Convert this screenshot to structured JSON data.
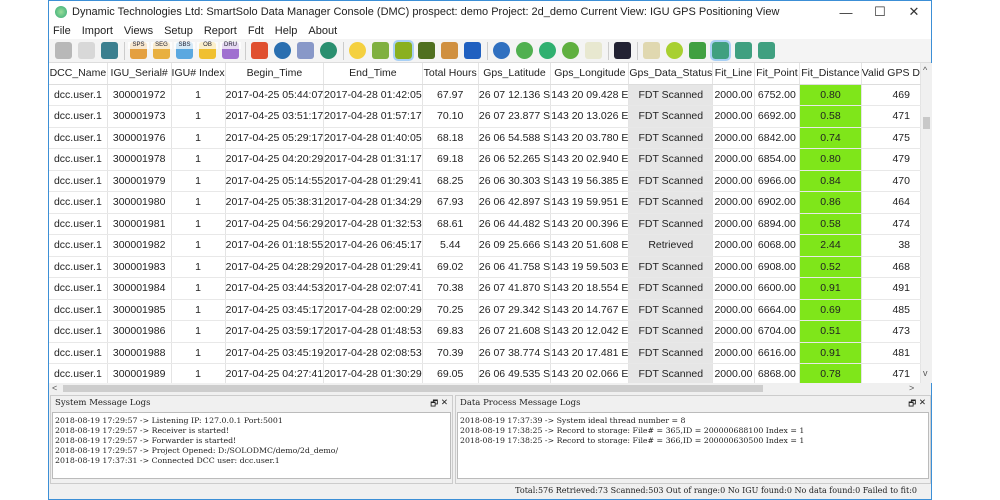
{
  "window": {
    "title": "Dynamic Technologies Ltd: SmartSolo Data Manager Console (DMC) prospect: demo  Project: 2d_demo   Current View: IGU GPS Positioning View",
    "minimize": "—",
    "maximize": "☐",
    "close": "✕"
  },
  "menu": [
    "File",
    "Import",
    "Views",
    "Setup",
    "Report",
    "Fdt",
    "Help",
    "About"
  ],
  "toolbar": [
    {
      "name": "new-project",
      "color": "#b8b8b8"
    },
    {
      "name": "open",
      "color": "#d8d8d8"
    },
    {
      "name": "robot",
      "color": "#3b7f8f"
    },
    null,
    {
      "name": "import-sps",
      "color": "#e4a040",
      "label": "SPS"
    },
    {
      "name": "import-seg",
      "color": "#e8b040",
      "label": "SEG"
    },
    {
      "name": "import-sbs",
      "color": "#5aa8e0",
      "label": "SBS"
    },
    {
      "name": "import-ob",
      "color": "#f0c030",
      "label": "OB"
    },
    {
      "name": "import-dru",
      "color": "#a070d0",
      "label": "DRU"
    },
    null,
    {
      "name": "list",
      "color": "#e05030"
    },
    {
      "name": "globe",
      "color": "#2a6fb0",
      "round": true
    },
    {
      "name": "link",
      "color": "#8898c8"
    },
    {
      "name": "grid-globe",
      "color": "#2a8f6f",
      "round": true
    },
    null,
    {
      "name": "sun",
      "color": "#f4d040",
      "round": true
    },
    {
      "name": "map-pin",
      "color": "#80b040"
    },
    {
      "name": "gps-view",
      "color": "#8ab020",
      "active": true
    },
    {
      "name": "terrain",
      "color": "#507020"
    },
    {
      "name": "folder-photo",
      "color": "#d09040"
    },
    {
      "name": "book",
      "color": "#2060c0"
    },
    null,
    {
      "name": "world",
      "color": "#3070c0",
      "round": true
    },
    {
      "name": "wave",
      "color": "#50b050",
      "round": true
    },
    {
      "name": "refresh",
      "color": "#30b070",
      "round": true
    },
    {
      "name": "filter",
      "color": "#60b040",
      "round": true
    },
    {
      "name": "document",
      "color": "#e8e8d0"
    },
    null,
    {
      "name": "device",
      "color": "#223"
    },
    null,
    {
      "name": "report-filter",
      "color": "#e0d8b0"
    },
    {
      "name": "ball",
      "color": "#a8d030",
      "round": true
    },
    {
      "name": "target",
      "color": "#40a040"
    },
    {
      "name": "checklist",
      "color": "#40a080",
      "active": true
    },
    {
      "name": "checklist-remove",
      "color": "#40a080"
    },
    {
      "name": "checklist-add",
      "color": "#40a080"
    }
  ],
  "table": {
    "columns": [
      "DCC_Name",
      "IGU_Serial#",
      "IGU# Index",
      "Begin_Time",
      "End_Time",
      "Total Hours",
      "Gps_Latitude",
      "Gps_Longitude",
      "Gps_Data_Status",
      "Fit_Line",
      "Fit_Point",
      "Fit_Distance",
      "Valid GPS D"
    ],
    "fit_distance_color": "#7fe61a",
    "rows": [
      [
        "dcc.user.1",
        "300001972",
        "1",
        "2017-04-25 05:44:07",
        "2017-04-28 01:42:05",
        "67.97",
        "26 07 12.136 S",
        "143 20 09.428 E",
        "FDT Scanned",
        "2000.00",
        "6752.00",
        "0.80",
        "469"
      ],
      [
        "dcc.user.1",
        "300001973",
        "1",
        "2017-04-25 03:51:17",
        "2017-04-28 01:57:17",
        "70.10",
        "26 07 23.877 S",
        "143 20 13.026 E",
        "FDT Scanned",
        "2000.00",
        "6692.00",
        "0.58",
        "471"
      ],
      [
        "dcc.user.1",
        "300001976",
        "1",
        "2017-04-25 05:29:17",
        "2017-04-28 01:40:05",
        "68.18",
        "26 06 54.588 S",
        "143 20 03.780 E",
        "FDT Scanned",
        "2000.00",
        "6842.00",
        "0.74",
        "475"
      ],
      [
        "dcc.user.1",
        "300001978",
        "1",
        "2017-04-25 04:20:29",
        "2017-04-28 01:31:17",
        "69.18",
        "26 06 52.265 S",
        "143 20 02.940 E",
        "FDT Scanned",
        "2000.00",
        "6854.00",
        "0.80",
        "479"
      ],
      [
        "dcc.user.1",
        "300001979",
        "1",
        "2017-04-25 05:14:55",
        "2017-04-28 01:29:41",
        "68.25",
        "26 06 30.303 S",
        "143 19 56.385 E",
        "FDT Scanned",
        "2000.00",
        "6966.00",
        "0.84",
        "470"
      ],
      [
        "dcc.user.1",
        "300001980",
        "1",
        "2017-04-25 05:38:31",
        "2017-04-28 01:34:29",
        "67.93",
        "26 06 42.897 S",
        "143 19 59.951 E",
        "FDT Scanned",
        "2000.00",
        "6902.00",
        "0.86",
        "464"
      ],
      [
        "dcc.user.1",
        "300001981",
        "1",
        "2017-04-25 04:56:29",
        "2017-04-28 01:32:53",
        "68.61",
        "26 06 44.482 S",
        "143 20 00.396 E",
        "FDT Scanned",
        "2000.00",
        "6894.00",
        "0.58",
        "474"
      ],
      [
        "dcc.user.1",
        "300001982",
        "1",
        "2017-04-26 01:18:55",
        "2017-04-26 06:45:17",
        "5.44",
        "26 09 25.666 S",
        "143 20 51.608 E",
        "Retrieved",
        "2000.00",
        "6068.00",
        "2.44",
        "38"
      ],
      [
        "dcc.user.1",
        "300001983",
        "1",
        "2017-04-25 04:28:29",
        "2017-04-28 01:29:41",
        "69.02",
        "26 06 41.758 S",
        "143 19 59.503 E",
        "FDT Scanned",
        "2000.00",
        "6908.00",
        "0.52",
        "468"
      ],
      [
        "dcc.user.1",
        "300001984",
        "1",
        "2017-04-25 03:44:53",
        "2017-04-28 02:07:41",
        "70.38",
        "26 07 41.870 S",
        "143 20 18.554 E",
        "FDT Scanned",
        "2000.00",
        "6600.00",
        "0.91",
        "491"
      ],
      [
        "dcc.user.1",
        "300001985",
        "1",
        "2017-04-25 03:45:17",
        "2017-04-28 02:00:29",
        "70.25",
        "26 07 29.342 S",
        "143 20 14.767 E",
        "FDT Scanned",
        "2000.00",
        "6664.00",
        "0.69",
        "485"
      ],
      [
        "dcc.user.1",
        "300001986",
        "1",
        "2017-04-25 03:59:17",
        "2017-04-28 01:48:53",
        "69.83",
        "26 07 21.608 S",
        "143 20 12.042 E",
        "FDT Scanned",
        "2000.00",
        "6704.00",
        "0.51",
        "473"
      ],
      [
        "dcc.user.1",
        "300001988",
        "1",
        "2017-04-25 03:45:19",
        "2017-04-28 02:08:53",
        "70.39",
        "26 07 38.774 S",
        "143 20 17.481 E",
        "FDT Scanned",
        "2000.00",
        "6616.00",
        "0.91",
        "481"
      ],
      [
        "dcc.user.1",
        "300001989",
        "1",
        "2017-04-25 04:27:41",
        "2017-04-28 01:30:29",
        "69.05",
        "26 06 49.535 S",
        "143 20 02.066 E",
        "FDT Scanned",
        "2000.00",
        "6868.00",
        "0.78",
        "471"
      ]
    ]
  },
  "system_log": {
    "title": "System Message Logs",
    "lines": [
      "2018-08-19 17:29:57 -> Listening IP: 127.0.0.1 Port:5001",
      "2018-08-19 17:29:57 -> Receiver is started!",
      "2018-08-19 17:29:57 -> Forwarder is started!",
      "2018-08-19 17:29:57 -> Project Opened: D:/SOLODMC/demo/2d_demo/",
      "2018-08-19 17:37:31 -> Connected DCC user: dcc.user.1"
    ]
  },
  "process_log": {
    "title": "Data Process Message Logs",
    "lines": [
      "2018-08-19 17:37:39 -> System ideal thread number = 8",
      "2018-08-19 17:38:25 -> Record to storage: File# = 365,ID = 200000688100 Index = 1",
      "2018-08-19 17:38:25 -> Record to storage: File# = 366,ID = 200000630500 Index = 1"
    ]
  },
  "panel_buttons": {
    "float": "🗗",
    "close": "✕"
  },
  "status": "Total:576  Retrieved:73  Scanned:503 Out of range:0 No IGU found:0  No data found:0  Failed to fit:0"
}
